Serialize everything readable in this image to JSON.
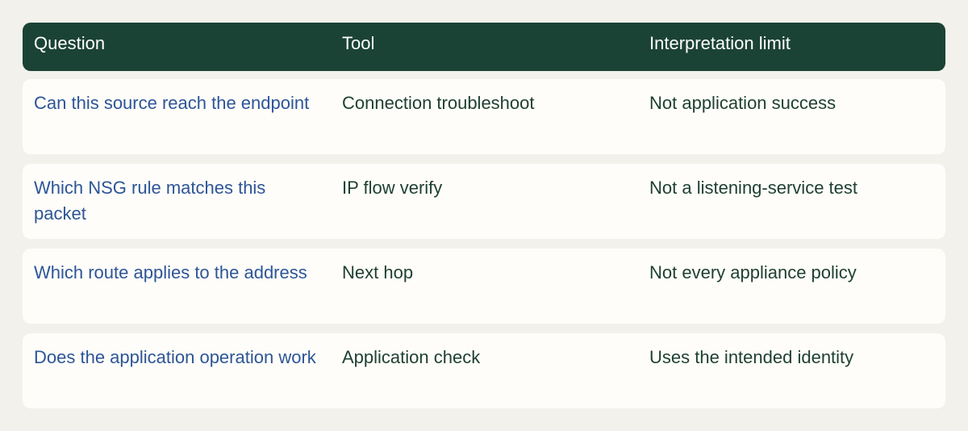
{
  "table": {
    "headers": [
      "Question",
      "Tool",
      "Interpretation limit"
    ],
    "rows": [
      {
        "question": "Can this source reach the endpoint",
        "tool": "Connection troubleshoot",
        "limit": "Not application success"
      },
      {
        "question": "Which NSG rule matches this packet",
        "tool": "IP flow verify",
        "limit": "Not a listening-service test"
      },
      {
        "question": "Which route applies to the address",
        "tool": "Next hop",
        "limit": "Not every appliance policy"
      },
      {
        "question": "Does the application operation work",
        "tool": "Application check",
        "limit": "Uses the intended identity"
      }
    ]
  },
  "colors": {
    "header_bg": "#1b4335",
    "page_bg": "#f3f1eb",
    "row_bg": "#fefdf9",
    "question_text": "#2d5597",
    "body_text": "#1e3f33"
  }
}
